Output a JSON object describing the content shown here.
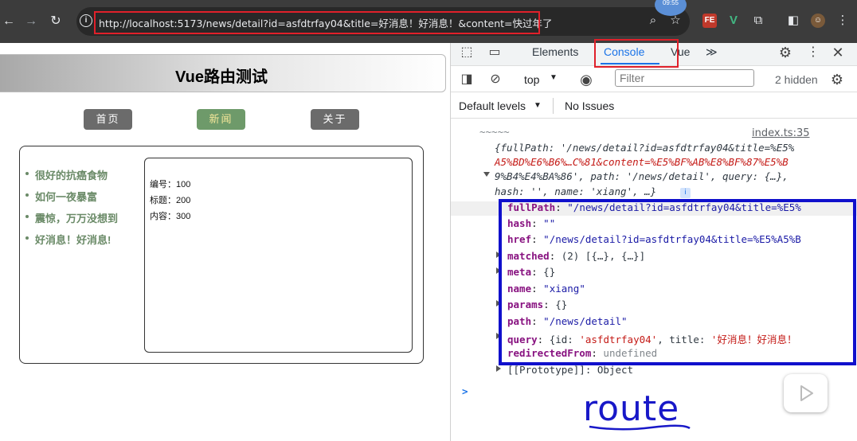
{
  "browser": {
    "url": "http://localhost:5173/news/detail?id=asfdtrfay04&title=好消息！好消息！&content=快过年了",
    "timer": "09:55"
  },
  "page": {
    "title": "Vue路由测试",
    "nav": [
      {
        "label": "首页",
        "color": "#6b6b6b"
      },
      {
        "label": "新闻",
        "color": "#6e9a6a",
        "text_color": "#f5e79a"
      },
      {
        "label": "关于",
        "color": "#6b6b6b"
      }
    ],
    "news": [
      "很好的抗癌食物",
      "如何一夜暴富",
      "震惊，万万没想到",
      "好消息！好消息!"
    ],
    "detail": {
      "id_label": "编号：100",
      "title_label": "标题：200",
      "content_label": "内容：300"
    }
  },
  "devtools": {
    "tabs": {
      "elements": "Elements",
      "console": "Console",
      "vue": "Vue",
      "more": "≫"
    },
    "toolbar": {
      "context": "top",
      "filter_placeholder": "Filter",
      "hidden": "2 hidden"
    },
    "levels": {
      "label": "Default levels",
      "issues": "No Issues"
    },
    "console": {
      "source": "index.ts:35",
      "tilde": "~~~~~",
      "summary_line1": "{fullPath: '/news/detail?id=asfdtrfay04&title=%E5%",
      "summary_line2": "A5%BD%E6%B6%…C%81&content=%E5%BF%AB%E8%BF%87%E5%B",
      "summary_line3": "9%B4%E4%BA%86', path: '/news/detail', query: {…},",
      "summary_line4": "hash: '', name: 'xiang', …}",
      "props": {
        "fullPath_key": "fullPath",
        "fullPath_val": "\"/news/detail?id=asfdtrfay04&title=%E5%",
        "hash_key": "hash",
        "hash_val": "\"\"",
        "href_key": "href",
        "href_val": "\"/news/detail?id=asfdtrfay04&title=%E5%A5%B",
        "matched_key": "matched",
        "matched_val": "(2) [{…}, {…}]",
        "meta_key": "meta",
        "meta_val": "{}",
        "name_key": "name",
        "name_val": "\"xiang\"",
        "params_key": "params",
        "params_val": "{}",
        "path_key": "path",
        "path_val": "\"/news/detail\"",
        "query_key": "query",
        "query_val_a": "{id: ",
        "query_val_b": "'asfdtrfay04'",
        "query_val_c": ", title: ",
        "query_val_d": "'好消息！好消息！",
        "redirected_key": "redirectedFrom",
        "redirected_val": "undefined",
        "prototype": "[[Prototype]]: Object"
      },
      "prompt": ">"
    }
  },
  "annotation": {
    "handwriting": "route"
  },
  "colors": {
    "highlight_red": "#e0202a",
    "highlight_blue": "#1010cc"
  }
}
